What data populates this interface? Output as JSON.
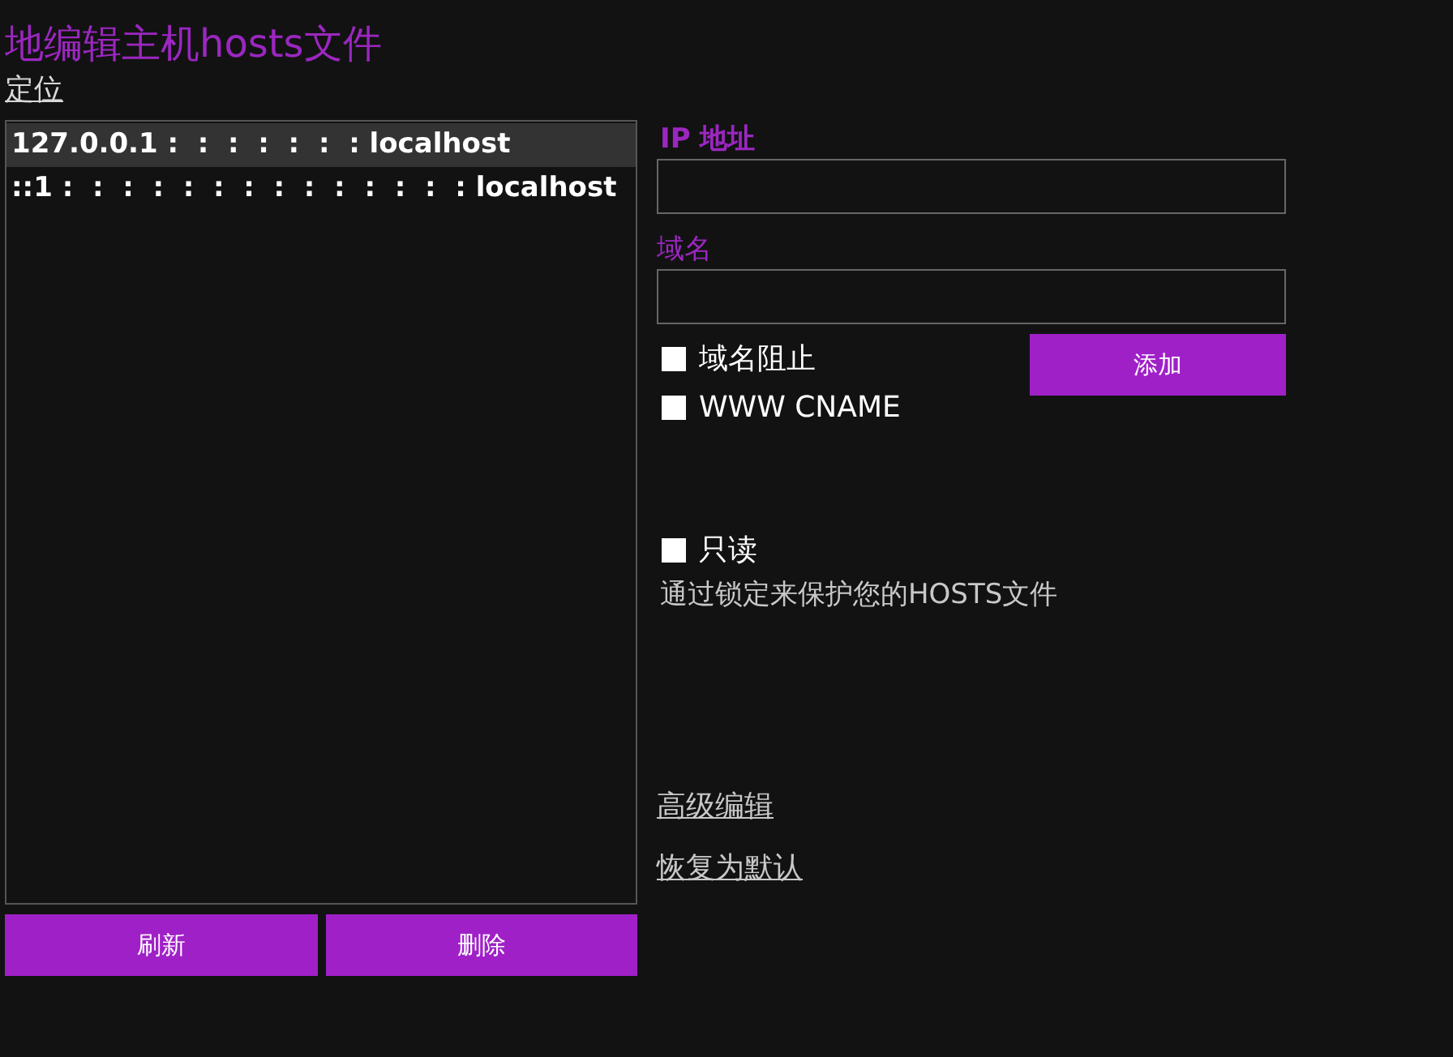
{
  "title": "地编辑主机hosts文件",
  "locate_link": "定位",
  "hosts_list": [
    {
      "text": "127.0.0.1 :  :  :  :  :  :  : localhost",
      "selected": true
    },
    {
      "text": "::1 :  :  :  :  :  :  :  :  :  :  :  :  :  : localhost",
      "selected": false
    }
  ],
  "list_buttons": [
    "刷新",
    "删除"
  ],
  "ip_field": {
    "label": "IP 地址"
  },
  "domain_field": {
    "label": "域名"
  },
  "options": [
    {
      "label": "域名阻止",
      "checked": false
    },
    {
      "label": "WWW CNAME",
      "checked": false
    }
  ],
  "add_button": "添加",
  "readonly": {
    "label": "只读",
    "checked": false
  },
  "readonly_hint": "通过锁定来保护您的HOSTS文件",
  "links": [
    "高级编辑",
    "恢复为默认"
  ]
}
